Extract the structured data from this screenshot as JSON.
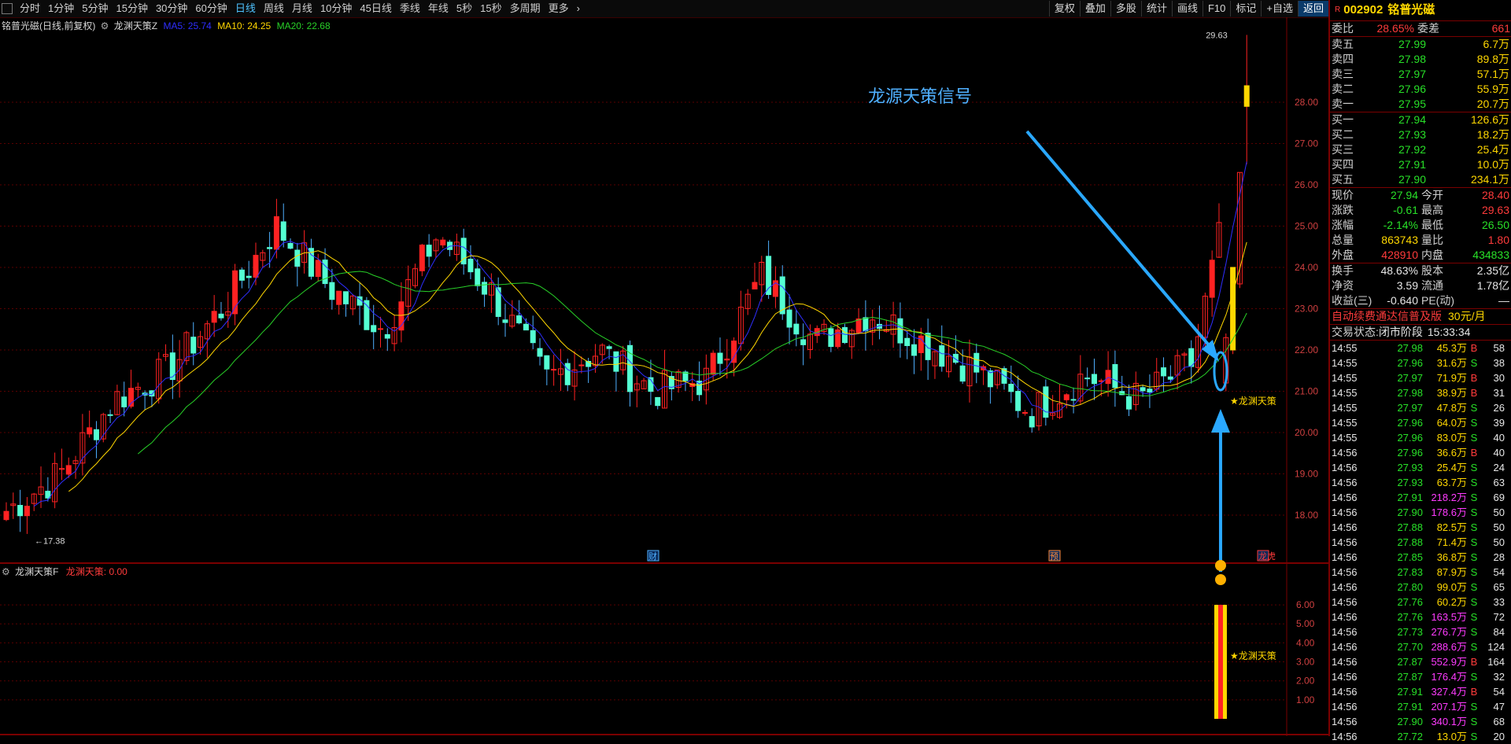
{
  "toolbar": {
    "periods": [
      "分时",
      "1分钟",
      "5分钟",
      "15分钟",
      "30分钟",
      "60分钟",
      "日线",
      "周线",
      "月线",
      "10分钟",
      "45日线",
      "季线",
      "年线",
      "5秒",
      "15秒",
      "多周期",
      "更多"
    ],
    "active_period": "日线",
    "tools": [
      "复权",
      "叠加",
      "多股",
      "统计",
      "画线",
      "F10",
      "标记",
      "+自选",
      "返回"
    ]
  },
  "main_legend": {
    "title": "铭普光磁(日线,前复权)",
    "indicator": "龙渊天策Z",
    "ma5": "MA5: 25.74",
    "ma10": "MA10: 24.25",
    "ma20": "MA20: 22.68"
  },
  "sub_legend": {
    "title": "龙渊天策F",
    "value": "龙渊天策: 0.00"
  },
  "annotations": {
    "signal_text": "龙源天策信号",
    "star_label_main": "★龙渊天策",
    "star_label_sub": "★龙渊天策",
    "high_label": "29.63",
    "low_label": "17.38",
    "badge_cai": "财",
    "badge_yu": "预",
    "badge_lhb": "龙虎"
  },
  "chart_data": {
    "type": "candlestick",
    "ylim": [
      17.38,
      29.63
    ],
    "y_ticks": [
      "28.00",
      "27.00",
      "26.00",
      "25.00",
      "24.00",
      "23.00",
      "22.00",
      "21.00",
      "20.00",
      "19.00",
      "18.00"
    ],
    "sub_y_ticks": [
      "6.00",
      "5.00",
      "4.00",
      "3.00",
      "2.00",
      "1.00"
    ],
    "sub_ylim": [
      0,
      6.5
    ],
    "last_signal_value": 6.0
  },
  "side": {
    "code": "002902",
    "name": "铭普光磁",
    "weibi_label": "委比",
    "weibi": "28.65%",
    "weicha_label": "委差",
    "weicha": "661",
    "asks": [
      {
        "label": "卖五",
        "price": "27.99",
        "vol": "6.7万"
      },
      {
        "label": "卖四",
        "price": "27.98",
        "vol": "89.8万"
      },
      {
        "label": "卖三",
        "price": "27.97",
        "vol": "57.1万"
      },
      {
        "label": "卖二",
        "price": "27.96",
        "vol": "55.9万"
      },
      {
        "label": "卖一",
        "price": "27.95",
        "vol": "20.7万"
      }
    ],
    "bids": [
      {
        "label": "买一",
        "price": "27.94",
        "vol": "126.6万"
      },
      {
        "label": "买二",
        "price": "27.93",
        "vol": "18.2万"
      },
      {
        "label": "买三",
        "price": "27.92",
        "vol": "25.4万"
      },
      {
        "label": "买四",
        "price": "27.91",
        "vol": "10.0万"
      },
      {
        "label": "买五",
        "price": "27.90",
        "vol": "234.1万"
      }
    ],
    "stats": [
      {
        "l1": "现价",
        "v1": "27.94",
        "c1": "grn",
        "l2": "今开",
        "v2": "28.40",
        "c2": "red"
      },
      {
        "l1": "涨跌",
        "v1": "-0.61",
        "c1": "grn",
        "l2": "最高",
        "v2": "29.63",
        "c2": "red"
      },
      {
        "l1": "涨幅",
        "v1": "-2.14%",
        "c1": "grn",
        "l2": "最低",
        "v2": "26.50",
        "c2": "grn"
      },
      {
        "l1": "总量",
        "v1": "863743",
        "c1": "yel",
        "l2": "量比",
        "v2": "1.80",
        "c2": "red"
      },
      {
        "l1": "外盘",
        "v1": "428910",
        "c1": "red",
        "l2": "内盘",
        "v2": "434833",
        "c2": "grn"
      }
    ],
    "stats2": [
      {
        "l1": "换手",
        "v1": "48.63%",
        "l2": "股本",
        "v2": "2.35亿"
      },
      {
        "l1": "净资",
        "v1": "3.59",
        "l2": "流通",
        "v2": "1.78亿"
      },
      {
        "l1": "收益(三)",
        "v1": "-0.640",
        "l2": "PE(动)",
        "v2": "—"
      }
    ],
    "promo": "自动续费通达信普及版",
    "promo_price": "30元/月",
    "status_label": "交易状态:",
    "status": "闭市阶段",
    "status_time": "15:33:34",
    "ticks": [
      {
        "t": "14:55",
        "p": "27.98",
        "v": "45.3万",
        "bs": "B",
        "n": "58"
      },
      {
        "t": "14:55",
        "p": "27.96",
        "v": "31.6万",
        "bs": "S",
        "n": "38"
      },
      {
        "t": "14:55",
        "p": "27.97",
        "v": "71.9万",
        "bs": "B",
        "n": "30"
      },
      {
        "t": "14:55",
        "p": "27.98",
        "v": "38.9万",
        "bs": "B",
        "n": "31"
      },
      {
        "t": "14:55",
        "p": "27.97",
        "v": "47.8万",
        "bs": "S",
        "n": "26"
      },
      {
        "t": "14:55",
        "p": "27.96",
        "v": "64.0万",
        "bs": "S",
        "n": "39"
      },
      {
        "t": "14:55",
        "p": "27.96",
        "v": "83.0万",
        "bs": "S",
        "n": "40"
      },
      {
        "t": "14:56",
        "p": "27.96",
        "v": "36.6万",
        "bs": "B",
        "n": "40"
      },
      {
        "t": "14:56",
        "p": "27.93",
        "v": "25.4万",
        "bs": "S",
        "n": "24"
      },
      {
        "t": "14:56",
        "p": "27.93",
        "v": "63.7万",
        "bs": "S",
        "n": "63"
      },
      {
        "t": "14:56",
        "p": "27.91",
        "v": "218.2万",
        "bs": "S",
        "n": "69"
      },
      {
        "t": "14:56",
        "p": "27.90",
        "v": "178.6万",
        "bs": "S",
        "n": "50"
      },
      {
        "t": "14:56",
        "p": "27.88",
        "v": "82.5万",
        "bs": "S",
        "n": "50"
      },
      {
        "t": "14:56",
        "p": "27.88",
        "v": "71.4万",
        "bs": "S",
        "n": "50"
      },
      {
        "t": "14:56",
        "p": "27.85",
        "v": "36.8万",
        "bs": "S",
        "n": "28"
      },
      {
        "t": "14:56",
        "p": "27.83",
        "v": "87.9万",
        "bs": "S",
        "n": "54"
      },
      {
        "t": "14:56",
        "p": "27.80",
        "v": "99.0万",
        "bs": "S",
        "n": "65"
      },
      {
        "t": "14:56",
        "p": "27.76",
        "v": "60.2万",
        "bs": "S",
        "n": "33"
      },
      {
        "t": "14:56",
        "p": "27.76",
        "v": "163.5万",
        "bs": "S",
        "n": "72"
      },
      {
        "t": "14:56",
        "p": "27.73",
        "v": "276.7万",
        "bs": "S",
        "n": "84"
      },
      {
        "t": "14:56",
        "p": "27.70",
        "v": "288.6万",
        "bs": "S",
        "n": "124"
      },
      {
        "t": "14:56",
        "p": "27.87",
        "v": "552.9万",
        "bs": "B",
        "n": "164"
      },
      {
        "t": "14:56",
        "p": "27.87",
        "v": "176.4万",
        "bs": "S",
        "n": "32"
      },
      {
        "t": "14:56",
        "p": "27.91",
        "v": "327.4万",
        "bs": "B",
        "n": "54"
      },
      {
        "t": "14:56",
        "p": "27.91",
        "v": "207.1万",
        "bs": "S",
        "n": "47"
      },
      {
        "t": "14:56",
        "p": "27.90",
        "v": "340.1万",
        "bs": "S",
        "n": "68"
      },
      {
        "t": "14:56",
        "p": "27.72",
        "v": "13.0万",
        "bs": "S",
        "n": "20"
      }
    ]
  }
}
